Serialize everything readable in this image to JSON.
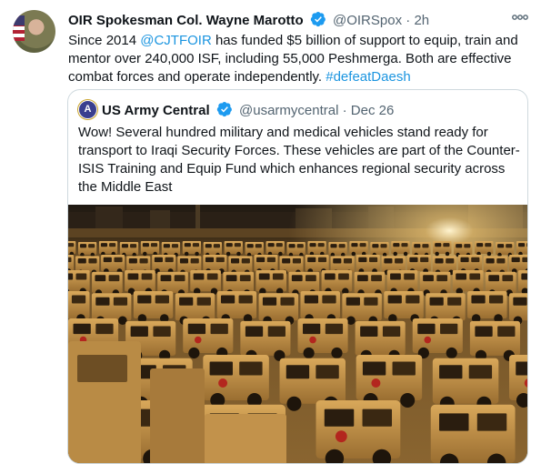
{
  "tweet": {
    "author_name": "OIR Spokesman Col. Wayne Marotto",
    "handle": "@OIRSpox",
    "separator": "·",
    "time": "2h",
    "text_parts": [
      "Since 2014 ",
      "@CJTFOIR",
      " has funded $5 billion of support to equip, train and mentor over 240,000 ISF, including 55,000 Peshmerga. Both are effective combat forces and operate independently. ",
      "#defeatDaesh"
    ]
  },
  "quoted_tweet": {
    "avatar_letter": "A",
    "author_name": "US Army Central",
    "handle": "@usarmycentral",
    "separator": "·",
    "date": "Dec 26",
    "text": "Wow!  Several hundred military and medical vehicles stand ready for transport to Iraqi Security Forces. These vehicles are part of the Counter-ISIS Training and Equip Fund which enhances regional security across the Middle East"
  },
  "icons": {
    "verified": "verified-badge-icon",
    "more": "more-options-icon"
  },
  "colors": {
    "link": "#1b95e0",
    "verified": "#1d9bf0",
    "secondary_text": "#536471",
    "border": "#cfd9de"
  }
}
